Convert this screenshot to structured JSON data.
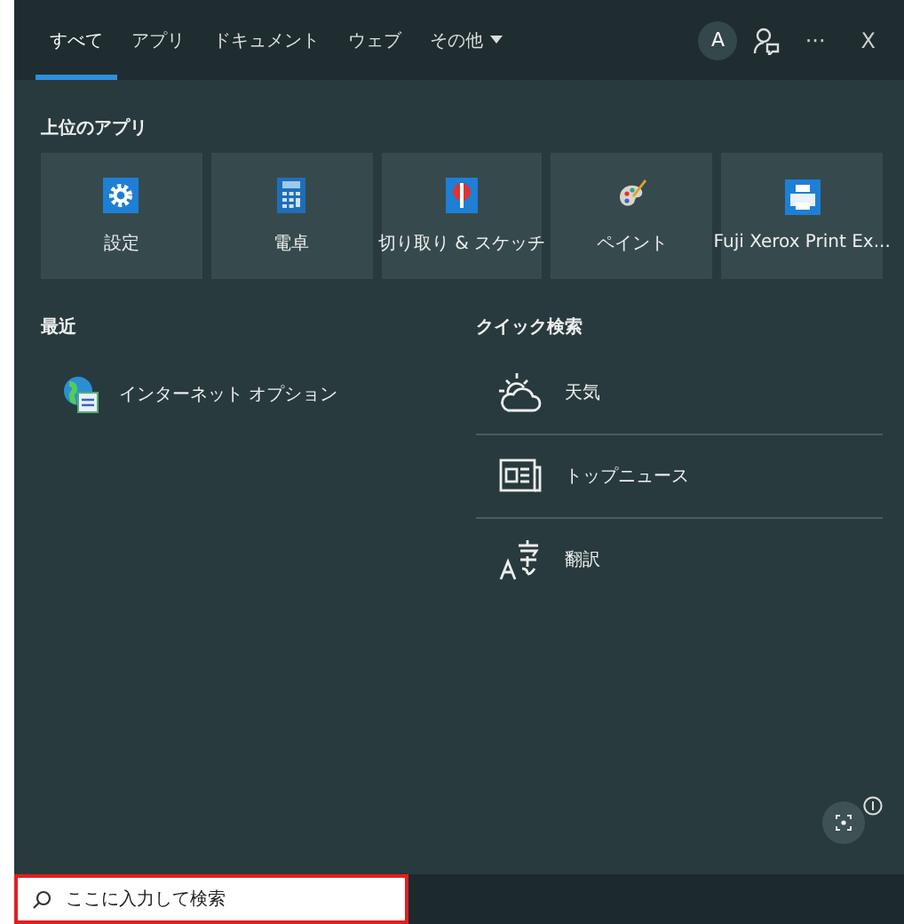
{
  "tabs": [
    {
      "label": "すべて",
      "selected": true
    },
    {
      "label": "アプリ",
      "selected": false
    },
    {
      "label": "ドキュメント",
      "selected": false
    },
    {
      "label": "ウェブ",
      "selected": false
    },
    {
      "label": "その他",
      "selected": false,
      "kind": "menu"
    }
  ],
  "header_actions": {
    "avatar": "A",
    "more": "···",
    "close": "X"
  },
  "top_apps": {
    "title": "上位のアプリ",
    "items": [
      {
        "label": "設定",
        "kind": "settings"
      },
      {
        "label": "電卓",
        "kind": "calculator"
      },
      {
        "label": "切り取り & スケッチ",
        "kind": "snip"
      },
      {
        "label": "ペイント",
        "kind": "paint"
      },
      {
        "label": "Fuji Xerox Print Ex...",
        "kind": "printer"
      }
    ]
  },
  "recent": {
    "title": "最近",
    "items": [
      {
        "label": "インターネット オプション",
        "kind": "internet-options"
      }
    ]
  },
  "quick_search": {
    "title": "クイック検索",
    "items": [
      {
        "label": "天気",
        "kind": "weather"
      },
      {
        "label": "トップニュース",
        "kind": "news"
      },
      {
        "label": "翻訳",
        "kind": "translate"
      }
    ]
  },
  "taskbar": {
    "search": {
      "placeholder": "ここに入力して検索",
      "highlighted": true
    }
  }
}
